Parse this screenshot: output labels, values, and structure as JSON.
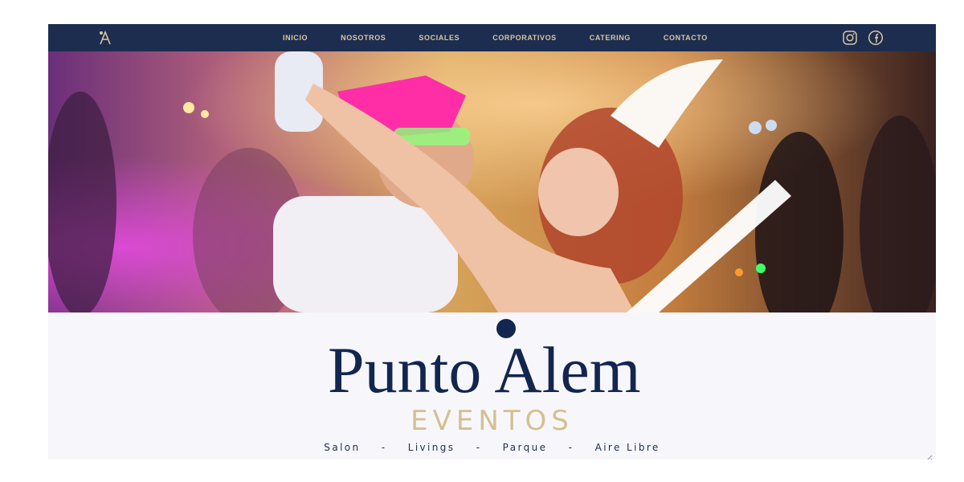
{
  "nav": {
    "items": [
      {
        "label": "INICIO"
      },
      {
        "label": "NOSOTROS"
      },
      {
        "label": "SOCIALES"
      },
      {
        "label": "CORPORATIVOS"
      },
      {
        "label": "CATERING"
      },
      {
        "label": "CONTACTO"
      }
    ],
    "social_icons": [
      "instagram-icon",
      "facebook-icon"
    ],
    "logo_icon": "brand-monogram-icon"
  },
  "brand": {
    "name": "Punto Alem",
    "tagline": "EVENTOS",
    "places": [
      "Salon",
      "Livings",
      "Parque",
      "Aire Libre"
    ],
    "separator": "-"
  },
  "colors": {
    "nav_bg": "#1d2d50",
    "nav_text": "#d8c7a4",
    "brand_navy": "#12264f",
    "brand_gold": "#d5bf91"
  }
}
